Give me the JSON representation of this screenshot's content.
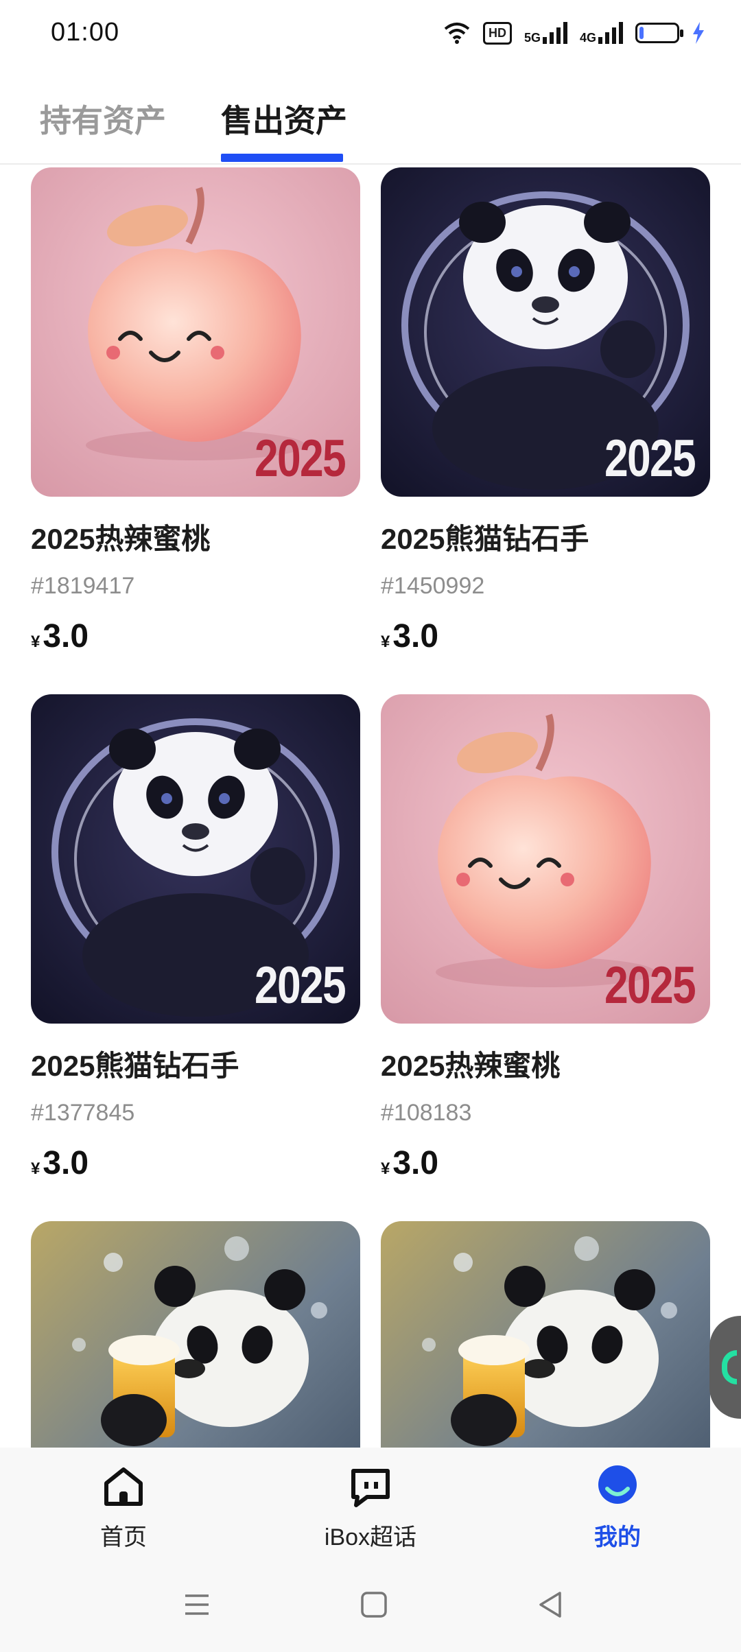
{
  "status_bar": {
    "time": "01:00",
    "hd_label": "HD",
    "net1_label": "5G",
    "net2_label": "4G",
    "battery_level": 0.12,
    "charging": true
  },
  "tabs": [
    {
      "label": "持有资产",
      "active": false
    },
    {
      "label": "售出资产",
      "active": true
    }
  ],
  "items": [
    {
      "title": "2025热辣蜜桃",
      "id": "#1819417",
      "currency": "¥",
      "price": "3.0",
      "badge": "2025",
      "art": "peach-art"
    },
    {
      "title": "2025熊猫钻石手",
      "id": "#1450992",
      "currency": "¥",
      "price": "3.0",
      "badge": "2025",
      "art": "panda-swirl-art"
    },
    {
      "title": "2025熊猫钻石手",
      "id": "#1377845",
      "currency": "¥",
      "price": "3.0",
      "badge": "2025",
      "art": "panda-swirl-art"
    },
    {
      "title": "2025热辣蜜桃",
      "id": "#108183",
      "currency": "¥",
      "price": "3.0",
      "badge": "2025",
      "art": "peach-art"
    },
    {
      "art": "panda-beer-art"
    },
    {
      "art": "panda-beer-art"
    }
  ],
  "bottom_nav": [
    {
      "label": "首页",
      "icon": "home-icon",
      "active": false
    },
    {
      "label": "iBox超话",
      "icon": "chat-icon",
      "active": false
    },
    {
      "label": "我的",
      "icon": "profile-icon",
      "active": true
    }
  ],
  "system_nav": [
    "menu-icon",
    "home-square-icon",
    "back-icon"
  ],
  "colors": {
    "accent": "#1f4ef5",
    "active_nav": "#1e4fe8",
    "peach_badge": "#b5283c",
    "panda_badge": "#f4f4f6",
    "float_ring": "#24e0a2"
  }
}
